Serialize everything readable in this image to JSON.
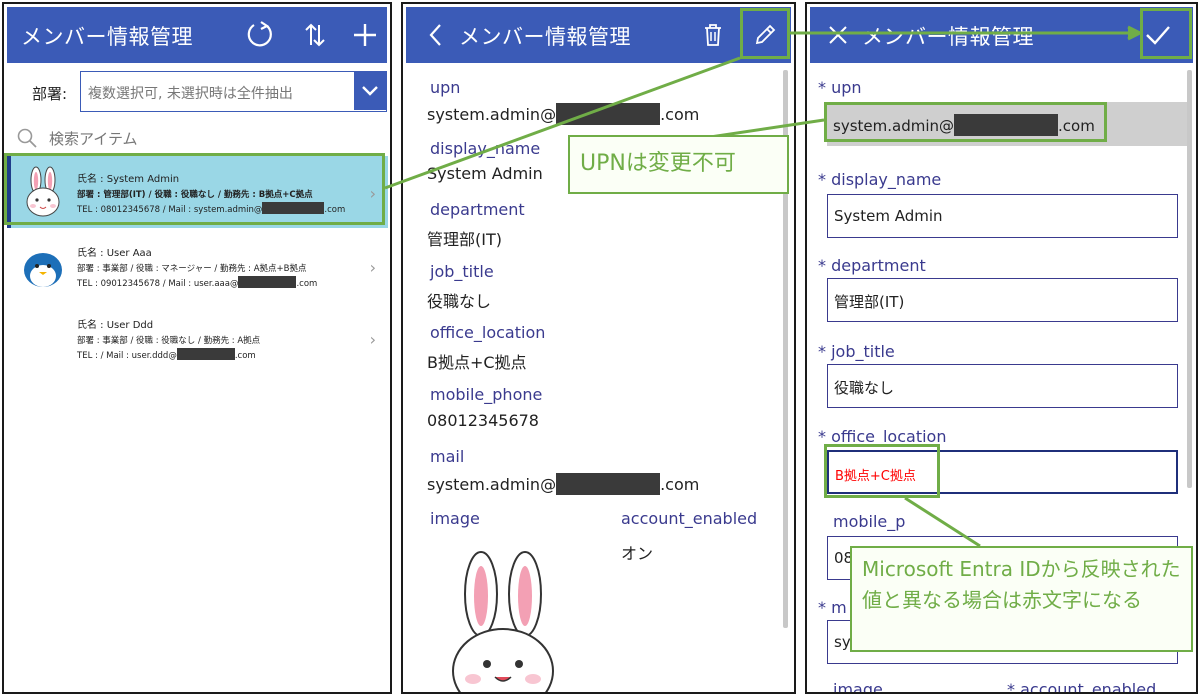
{
  "list_panel": {
    "title": "メンバー情報管理",
    "refresh_icon": "refresh-icon",
    "sort_icon": "sort-icon",
    "add_icon": "plus-icon",
    "dept_label": "部署:",
    "dept_placeholder": "複数選択可, 未選択時は全件抽出",
    "search_placeholder": "検索アイテム",
    "items": [
      {
        "name": "氏名 : System Admin",
        "line1": "部署 : 管理部(IT) / 役職 : 役職なし / 勤務先 : B拠点+C拠点",
        "tel": "TEL : 08012345678 / Mail : system.admin@",
        "tail": ".com",
        "avatar": "rabbit-avatar",
        "selected": true
      },
      {
        "name": "氏名 : User Aaa",
        "line1": "部署 : 事業部 / 役職 : マネージャー / 勤務先 : A拠点+B拠点",
        "tel": "TEL : 09012345678 / Mail : user.aaa@",
        "tail": ".com",
        "avatar": "penguin-avatar",
        "selected": false
      },
      {
        "name": "氏名 : User Ddd",
        "line1": "部署 : 事業部 / 役職 : 役職なし / 勤務先 : A拠点",
        "tel": "TEL : / Mail : user.ddd@",
        "tail": ".com",
        "avatar": "",
        "selected": false
      }
    ]
  },
  "detail_panel": {
    "title": "メンバー情報管理",
    "back_icon": "back-chevron-icon",
    "delete_icon": "trash-icon",
    "edit_icon": "pencil-icon",
    "fields": [
      {
        "label": "upn",
        "value": "system.admin@",
        "tail": ".com"
      },
      {
        "label": "display_name",
        "value": "System Admin"
      },
      {
        "label": "department",
        "value": "管理部(IT)"
      },
      {
        "label": "job_title",
        "value": "役職なし"
      },
      {
        "label": "office_location",
        "value": "B拠点+C拠点"
      },
      {
        "label": "mobile_phone",
        "value": "08012345678"
      },
      {
        "label": "mail",
        "value": "system.admin@",
        "tail": ".com"
      }
    ],
    "image_label": "image",
    "account_enabled_label": "account_enabled",
    "account_enabled_value": "オン"
  },
  "edit_panel": {
    "title": "メンバー情報管理",
    "close_icon": "close-icon",
    "save_icon": "check-icon",
    "fields": [
      {
        "label": "* upn",
        "value": "system.admin@",
        "tail": ".com"
      },
      {
        "label": "* display_name",
        "value": "System Admin"
      },
      {
        "label": "* department",
        "value": "管理部(IT)"
      },
      {
        "label": "* job_title",
        "value": "役職なし"
      },
      {
        "label": "* office_location",
        "value": "B拠点+C拠点",
        "value_color": "#ff0000"
      },
      {
        "label": "mobile_p",
        "value": "08"
      },
      {
        "label": "* m",
        "value": "sy"
      }
    ],
    "bottom_labels": [
      "image",
      "* account_enabled"
    ]
  },
  "callouts": {
    "upn_note": "UPNは変更不可",
    "red_note": "Microsoft Entra IDから反映された値と異なる場合は赤文字になる"
  },
  "colors": {
    "header": "#3b5bb7",
    "selected_row": "#9ad7e6",
    "field_label": "#3a3a8e",
    "callout": "#70ad47",
    "warning_text": "#ff0000"
  }
}
